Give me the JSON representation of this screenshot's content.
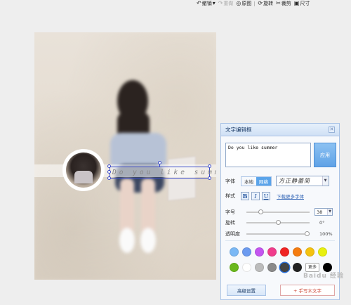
{
  "toolbar": {
    "items": [
      {
        "label": "撤销",
        "icon": "undo-icon",
        "glyph": "↶"
      },
      {
        "label": "重做",
        "icon": "redo-icon",
        "glyph": "↷"
      },
      {
        "label": "原图",
        "icon": "original-icon",
        "glyph": "◎"
      },
      {
        "label": "旋转",
        "icon": "rotate-icon",
        "glyph": "⟳"
      },
      {
        "label": "裁剪",
        "icon": "crop-icon",
        "glyph": "✂"
      },
      {
        "label": "尺寸",
        "icon": "resize-icon",
        "glyph": "▣"
      }
    ]
  },
  "canvas": {
    "overlay_text": "Do you like summer"
  },
  "panel": {
    "title": "文字编辑框",
    "close_label": "✕",
    "text_value": "Do you like summer",
    "apply_label": "应用",
    "font_label": "字体",
    "font_source": {
      "local": "本地",
      "web": "网络",
      "selected": "web"
    },
    "font_value": "方正静蕾简",
    "style_label": "样式",
    "styles": [
      {
        "label": "B",
        "name": "bold"
      },
      {
        "label": "I",
        "name": "italic"
      },
      {
        "label": "U",
        "name": "underline"
      }
    ],
    "download_fonts_label": "下载更多字体",
    "size_label": "字号",
    "size_value": "38",
    "size_level": 0.2,
    "rotation_label": "旋转",
    "rotation_value": "0°",
    "rotation_level": 0.5,
    "opacity_label": "透明度",
    "opacity_value": "100%",
    "opacity_level": 1.0,
    "colors_row1": [
      "#7ab8f5",
      "#6c9bf0",
      "#c455f0",
      "#f03c8c",
      "#f02424",
      "#f57c10",
      "#f5c210",
      "#e8f010"
    ],
    "colors_row2": [
      "#6ab81c",
      "#ffffff",
      "#bcbcbc",
      "#8a8a8a",
      "#444444",
      "#222222"
    ],
    "selected_color": "#444444",
    "more_label": "更多",
    "advanced_label": "高级设置",
    "add_text_label": "+ 手写木文字"
  },
  "watermark": "Baidu 经验"
}
